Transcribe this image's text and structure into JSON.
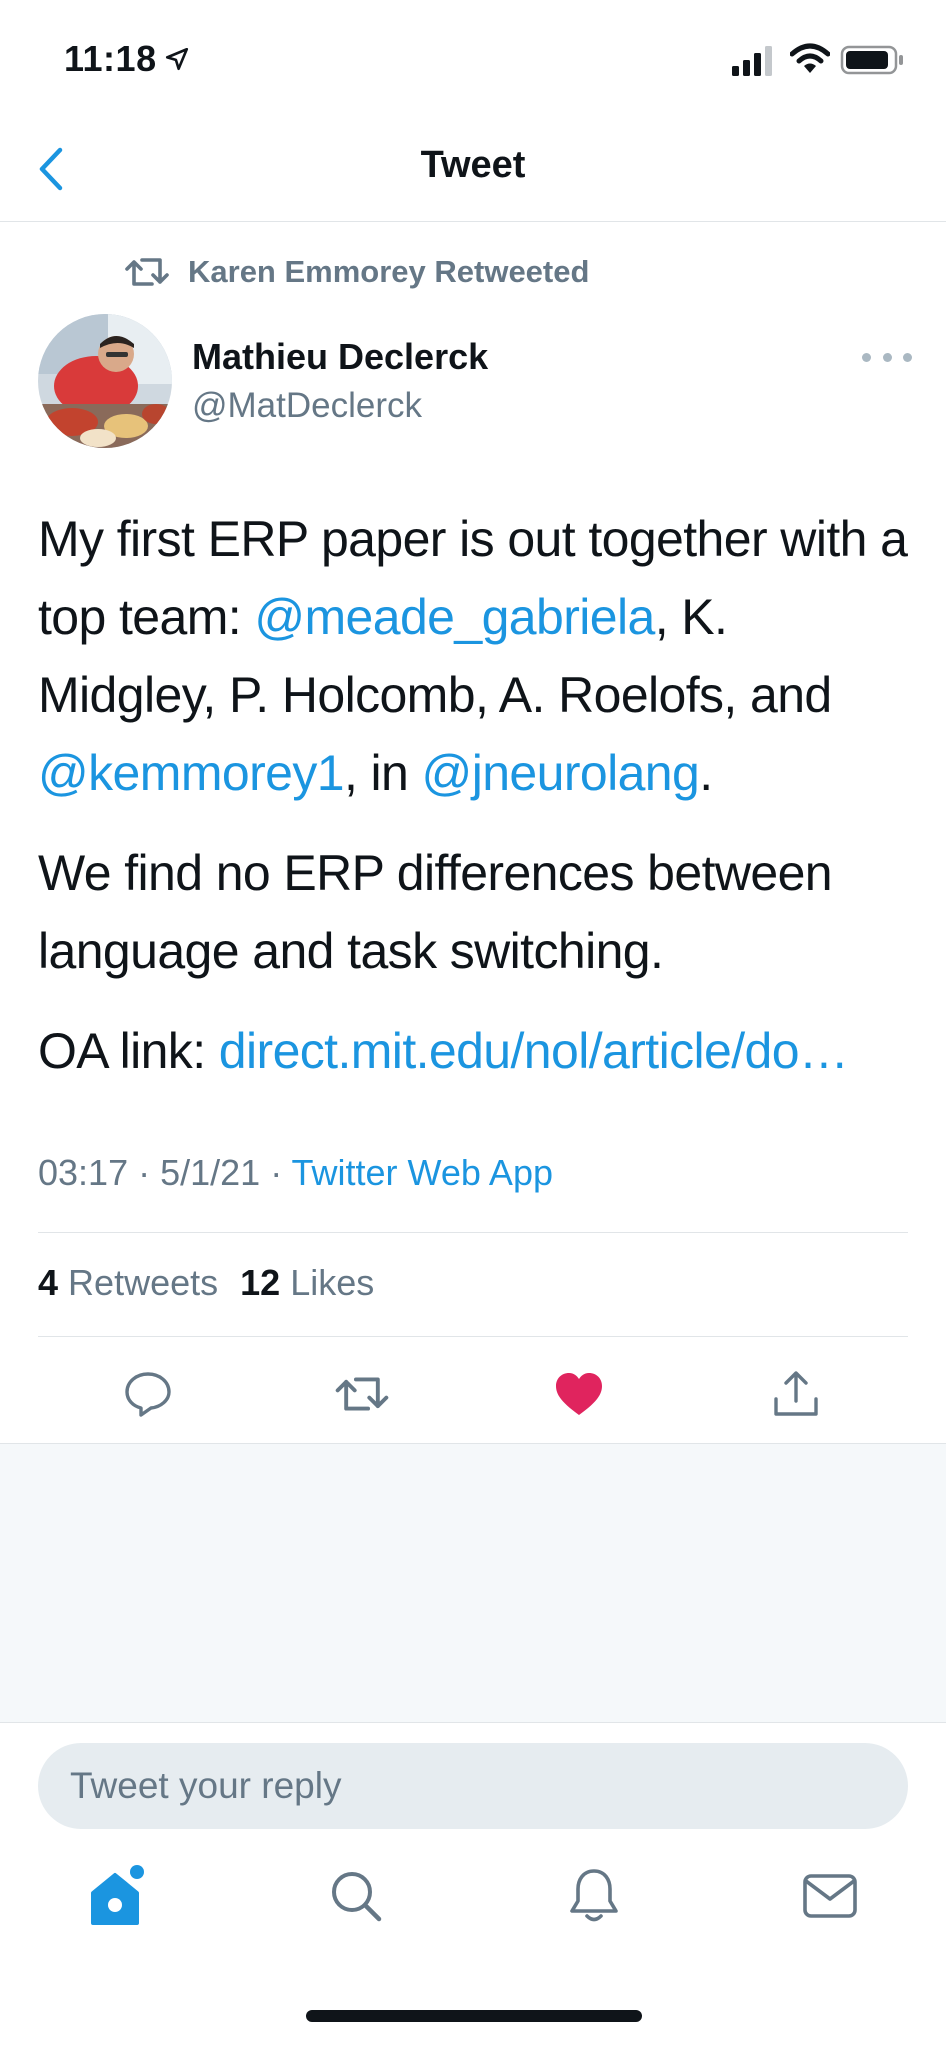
{
  "status_bar": {
    "time": "11:18"
  },
  "nav": {
    "title": "Tweet"
  },
  "retweet": {
    "label": "Karen Emmorey Retweeted"
  },
  "author": {
    "name": "Mathieu Declerck",
    "handle": "@MatDeclerck"
  },
  "tweet": {
    "p1_a": "My first ERP paper is out together with a top team: ",
    "p1_link1": "@meade_gabriela",
    "p1_b": ", K. Midgley, P. Holcomb, A. Roelofs, and ",
    "p1_link2": "@kemmorey1",
    "p1_c": ", in ",
    "p1_link3": "@jneurolang",
    "p1_d": ".",
    "p2": "We find no ERP differences between language and task switching.",
    "p3_a": "OA link: ",
    "p3_link": "direct.mit.edu/nol/article/do…"
  },
  "meta": {
    "time": "03:17",
    "sep1": " · ",
    "date": "5/1/21",
    "sep2": " · ",
    "app": "Twitter Web App"
  },
  "stats": {
    "retweets_count": "4",
    "retweets_label": "Retweets",
    "likes_count": "12",
    "likes_label": "Likes"
  },
  "reply": {
    "placeholder": "Tweet your reply"
  },
  "colors": {
    "accent": "#1b95e0",
    "like": "#e0245e",
    "muted": "#657786"
  },
  "icons": {
    "actions": [
      "reply-icon",
      "retweet-icon",
      "like-icon-filled",
      "share-icon"
    ],
    "tabs": [
      "home-icon",
      "search-icon",
      "notifications-icon",
      "messages-icon"
    ]
  }
}
